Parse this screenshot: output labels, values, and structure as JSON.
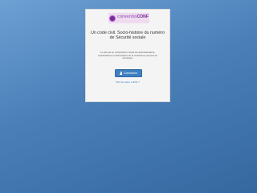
{
  "logo": {
    "brand_part1": "conventio",
    "brand_part2": "CONF",
    "tagline": "..."
  },
  "card": {
    "title": "Un code civil. Socio-histoire du numéro de Sécurité sociale",
    "description": "Le site est en construction. Seuls les administrateurs, coordinateurs et webmasters de la conférence peuvent se connecter.",
    "login_button": "Connexion",
    "forgot_link": "Mot de passe oublié ?"
  },
  "colors": {
    "accent": "#3f7fc0",
    "brand": "#6a1f8c"
  }
}
